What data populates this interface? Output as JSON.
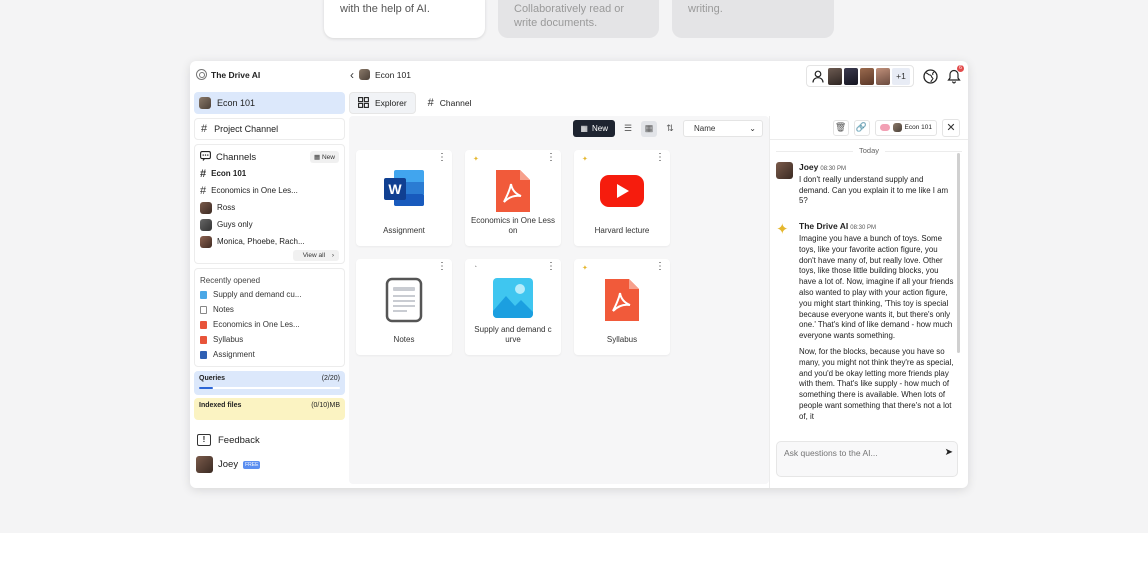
{
  "feature_cards": [
    {
      "text": "with the help of AI."
    },
    {
      "text": "Collaboratively read or write documents."
    },
    {
      "text": "writing."
    }
  ],
  "header": {
    "brand": "The Drive AI",
    "channel": "Econ 101",
    "extra_people": "+1",
    "notification_count": "6"
  },
  "sidebar": {
    "active": "Econ 101",
    "project_channel": "Project Channel",
    "channels_title": "Channels",
    "new_label": "New",
    "channels": [
      "Econ 101",
      "Economics in One Les...",
      "Ross",
      "Guys only",
      "Monica, Phoebe, Rach..."
    ],
    "view_all": "View all",
    "recent_title": "Recently opened",
    "recent": [
      "Supply and demand cu...",
      "Notes",
      "Economics in One Les...",
      "Syllabus",
      "Assignment"
    ],
    "queries_label": "Queries",
    "queries_value": "(2/20)",
    "queries_fraction": 0.1,
    "indexed_label": "Indexed files",
    "indexed_value": "(0/10)MB",
    "feedback": "Feedback",
    "user": "Joey",
    "plan": "FREE"
  },
  "tabs": {
    "explorer": "Explorer",
    "channel": "Channel"
  },
  "toolbar": {
    "new": "New",
    "sort": "Name"
  },
  "files": [
    {
      "name": "Assignment",
      "icon": "word-icon"
    },
    {
      "name": "Economics in One Less on",
      "icon": "pdf-icon"
    },
    {
      "name": "Harvard lecture",
      "icon": "youtube-icon"
    },
    {
      "name": "Notes",
      "icon": "notes-icon"
    },
    {
      "name": "Supply and demand c urve",
      "icon": "image-icon"
    },
    {
      "name": "Syllabus",
      "icon": "pdf-icon"
    }
  ],
  "chat": {
    "context": "Econ 101",
    "date": "Today",
    "messages": [
      {
        "author": "Joey",
        "time": "08:30 PM",
        "text": "I don't really understand supply and demand. Can you explain it to me like I am 5?"
      },
      {
        "author": "The Drive AI",
        "time": "08:30 PM",
        "paragraphs": [
          "Imagine you have a bunch of toys. Some toys, like your favorite action figure, you don't have many of, but really love. Other toys, like those little building blocks, you have a lot of. Now, imagine if all your friends also wanted to play with your action figure, you might start thinking, 'This toy is special because everyone wants it, but there's only one.' That's kind of like demand - how much everyone wants something.",
          "Now, for the blocks, because you have so many, you might not think they're as special, and you'd be okay letting more friends play with them. That's like supply - how much of something there is available. When lots of people want something that there's not a lot of, it"
        ]
      }
    ],
    "input_placeholder": "Ask questions to the AI..."
  }
}
